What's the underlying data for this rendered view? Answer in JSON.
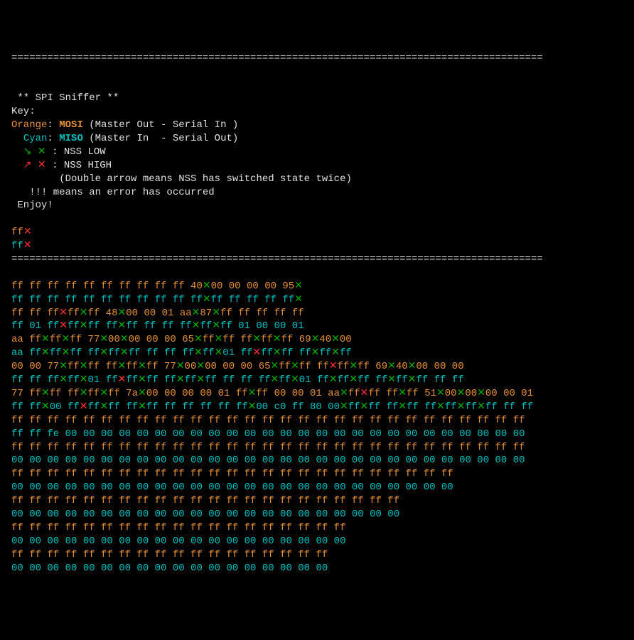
{
  "divider": "=========================================================================================",
  "header": {
    "title": " ** SPI Sniffer **",
    "key_label": "Key:",
    "orange_label": "Orange",
    "mosi": "MOSI",
    "mosi_desc": " (Master Out - Serial In )",
    "cyan_label": "Cyan",
    "miso": "MISO",
    "miso_desc": " (Master In  - Serial Out)",
    "nss_low_arrows": "  ↘ ✕",
    "nss_low_text": " : NSS LOW",
    "nss_high_arrows": "  ↗ ✕",
    "nss_high_text": " : NSS HIGH",
    "double_arrow": "        (Double arrow means NSS has switched state twice)",
    "err_text": "   !!! means an error has occurred",
    "enjoy": " Enjoy!"
  },
  "pre_lines": [
    [
      [
        "orange",
        "ff"
      ],
      [
        "red",
        "✕"
      ]
    ],
    [
      [
        "cyan",
        "ff"
      ],
      [
        "red",
        "✕"
      ]
    ]
  ],
  "lines": [
    [
      [
        "orange",
        "ff ff ff ff ff ff ff ff ff ff 40"
      ],
      [
        "green",
        "✕"
      ],
      [
        "orange",
        "00 00 00 00 95"
      ],
      [
        "green",
        "✕"
      ]
    ],
    [
      [
        "cyan",
        "ff ff ff ff ff ff ff ff ff ff ff"
      ],
      [
        "green",
        "✕"
      ],
      [
        "cyan",
        "ff ff ff ff ff"
      ],
      [
        "green",
        "✕"
      ]
    ],
    [
      [
        "orange",
        "ff ff ff"
      ],
      [
        "red",
        "✕"
      ],
      [
        "orange",
        "ff"
      ],
      [
        "green",
        "✕"
      ],
      [
        "orange",
        "ff 48"
      ],
      [
        "green",
        "✕"
      ],
      [
        "orange",
        "00 00 01 aa"
      ],
      [
        "green",
        "✕"
      ],
      [
        "orange",
        "87"
      ],
      [
        "green",
        "✕"
      ],
      [
        "orange",
        "ff ff ff ff ff"
      ]
    ],
    [
      [
        "cyan",
        "ff 01 ff"
      ],
      [
        "red",
        "✕"
      ],
      [
        "cyan",
        "ff"
      ],
      [
        "green",
        "✕"
      ],
      [
        "cyan",
        "ff ff"
      ],
      [
        "green",
        "✕"
      ],
      [
        "cyan",
        "ff ff ff ff"
      ],
      [
        "green",
        "✕"
      ],
      [
        "cyan",
        "ff"
      ],
      [
        "green",
        "✕"
      ],
      [
        "cyan",
        "ff 01 00 00 01"
      ]
    ],
    [
      [
        "orange",
        "aa ff"
      ],
      [
        "green",
        "✕"
      ],
      [
        "orange",
        "ff"
      ],
      [
        "green",
        "✕"
      ],
      [
        "orange",
        "ff 77"
      ],
      [
        "green",
        "✕"
      ],
      [
        "orange",
        "00"
      ],
      [
        "green",
        "✕"
      ],
      [
        "orange",
        "00 00 00 65"
      ],
      [
        "green",
        "✕"
      ],
      [
        "orange",
        "ff"
      ],
      [
        "green",
        "✕"
      ],
      [
        "orange",
        "ff ff"
      ],
      [
        "green",
        "✕"
      ],
      [
        "orange",
        "ff"
      ],
      [
        "green",
        "✕"
      ],
      [
        "orange",
        "ff 69"
      ],
      [
        "green",
        "✕"
      ],
      [
        "orange",
        "40"
      ],
      [
        "green",
        "✕"
      ],
      [
        "orange",
        "00"
      ]
    ],
    [
      [
        "cyan",
        "aa ff"
      ],
      [
        "green",
        "✕"
      ],
      [
        "cyan",
        "ff"
      ],
      [
        "green",
        "✕"
      ],
      [
        "cyan",
        "ff ff"
      ],
      [
        "green",
        "✕"
      ],
      [
        "cyan",
        "ff"
      ],
      [
        "green",
        "✕"
      ],
      [
        "cyan",
        "ff ff ff ff"
      ],
      [
        "green",
        "✕"
      ],
      [
        "cyan",
        "ff"
      ],
      [
        "green",
        "✕"
      ],
      [
        "cyan",
        "01 ff"
      ],
      [
        "red",
        "✕"
      ],
      [
        "cyan",
        "ff"
      ],
      [
        "green",
        "✕"
      ],
      [
        "cyan",
        "ff ff"
      ],
      [
        "green",
        "✕"
      ],
      [
        "cyan",
        "ff"
      ],
      [
        "green",
        "✕"
      ],
      [
        "cyan",
        "ff"
      ]
    ],
    [
      [
        "orange",
        "00 00 77"
      ],
      [
        "green",
        "✕"
      ],
      [
        "orange",
        "ff"
      ],
      [
        "green",
        "✕"
      ],
      [
        "orange",
        "ff ff"
      ],
      [
        "green",
        "✕"
      ],
      [
        "orange",
        "ff"
      ],
      [
        "green",
        "✕"
      ],
      [
        "orange",
        "ff 77"
      ],
      [
        "green",
        "✕"
      ],
      [
        "orange",
        "00"
      ],
      [
        "green",
        "✕"
      ],
      [
        "orange",
        "00 00 00 65"
      ],
      [
        "green",
        "✕"
      ],
      [
        "orange",
        "ff"
      ],
      [
        "green",
        "✕"
      ],
      [
        "orange",
        "ff ff"
      ],
      [
        "red",
        "✕"
      ],
      [
        "orange",
        "ff"
      ],
      [
        "green",
        "✕"
      ],
      [
        "orange",
        "ff 69"
      ],
      [
        "green",
        "✕"
      ],
      [
        "orange",
        "40"
      ],
      [
        "green",
        "✕"
      ],
      [
        "orange",
        "00 00 00"
      ]
    ],
    [
      [
        "cyan",
        "ff ff ff"
      ],
      [
        "green",
        "✕"
      ],
      [
        "cyan",
        "ff"
      ],
      [
        "green",
        "✕"
      ],
      [
        "cyan",
        "01 ff"
      ],
      [
        "red",
        "✕"
      ],
      [
        "cyan",
        "ff"
      ],
      [
        "green",
        "✕"
      ],
      [
        "cyan",
        "ff ff"
      ],
      [
        "green",
        "✕"
      ],
      [
        "cyan",
        "ff"
      ],
      [
        "green",
        "✕"
      ],
      [
        "cyan",
        "ff ff ff ff"
      ],
      [
        "green",
        "✕"
      ],
      [
        "cyan",
        "ff"
      ],
      [
        "green",
        "✕"
      ],
      [
        "cyan",
        "01 ff"
      ],
      [
        "green",
        "✕"
      ],
      [
        "cyan",
        "ff"
      ],
      [
        "green",
        "✕"
      ],
      [
        "cyan",
        "ff ff"
      ],
      [
        "green",
        "✕"
      ],
      [
        "cyan",
        "ff"
      ],
      [
        "green",
        "✕"
      ],
      [
        "cyan",
        "ff ff ff"
      ]
    ],
    [
      [
        "orange",
        "77 ff"
      ],
      [
        "green",
        "✕"
      ],
      [
        "orange",
        "ff ff"
      ],
      [
        "green",
        "✕"
      ],
      [
        "orange",
        "ff"
      ],
      [
        "green",
        "✕"
      ],
      [
        "orange",
        "ff 7a"
      ],
      [
        "green",
        "✕"
      ],
      [
        "orange",
        "00 00 00 00 01 ff"
      ],
      [
        "green",
        "✕"
      ],
      [
        "orange",
        "ff 00 00 01 aa"
      ],
      [
        "green",
        "✕"
      ],
      [
        "orange",
        "ff"
      ],
      [
        "red",
        "✕"
      ],
      [
        "orange",
        "ff ff"
      ],
      [
        "green",
        "✕"
      ],
      [
        "orange",
        "ff 51"
      ],
      [
        "green",
        "✕"
      ],
      [
        "orange",
        "00"
      ],
      [
        "green",
        "✕"
      ],
      [
        "orange",
        "00"
      ],
      [
        "green",
        "✕"
      ],
      [
        "orange",
        "00 00 01"
      ]
    ],
    [
      [
        "cyan",
        "ff ff"
      ],
      [
        "green",
        "✕"
      ],
      [
        "cyan",
        "00 ff"
      ],
      [
        "red",
        "✕"
      ],
      [
        "cyan",
        "ff"
      ],
      [
        "green",
        "✕"
      ],
      [
        "cyan",
        "ff ff"
      ],
      [
        "green",
        "✕"
      ],
      [
        "cyan",
        "ff ff ff ff ff ff"
      ],
      [
        "green",
        "✕"
      ],
      [
        "cyan",
        "00 c0 ff 80 00"
      ],
      [
        "green",
        "✕"
      ],
      [
        "cyan",
        "ff"
      ],
      [
        "green",
        "✕"
      ],
      [
        "cyan",
        "ff ff"
      ],
      [
        "green",
        "✕"
      ],
      [
        "cyan",
        "ff ff"
      ],
      [
        "green",
        "✕"
      ],
      [
        "cyan",
        "ff"
      ],
      [
        "green",
        "✕"
      ],
      [
        "cyan",
        "ff"
      ],
      [
        "green",
        "✕"
      ],
      [
        "cyan",
        "ff ff ff"
      ]
    ],
    [
      [
        "orange",
        "ff ff ff ff ff ff ff ff ff ff ff ff ff ff ff ff ff ff ff ff ff ff ff ff ff ff ff ff ff"
      ]
    ],
    [
      [
        "cyan",
        "ff ff fe 00 00 00 00 00 00 00 00 00 00 00 00 00 00 00 00 00 00 00 00 00 00 00 00 00 00"
      ]
    ],
    [
      [
        "orange",
        "ff ff ff ff ff ff ff ff ff ff ff ff ff ff ff ff ff ff ff ff ff ff ff ff ff ff ff ff ff"
      ]
    ],
    [
      [
        "cyan",
        "00 00 00 00 00 00 00 00 00 00 00 00 00 00 00 00 00 00 00 00 00 00 00 00 00 00 00 00 00"
      ]
    ],
    [
      [
        "orange",
        "ff ff ff ff ff ff ff ff ff ff ff ff ff ff ff ff ff ff ff ff ff ff ff ff ff"
      ]
    ],
    [
      [
        "cyan",
        "00 00 00 00 00 00 00 00 00 00 00 00 00 00 00 00 00 00 00 00 00 00 00 00 00"
      ]
    ],
    [
      [
        "orange",
        "ff ff ff ff ff ff ff ff ff ff ff ff ff ff ff ff ff ff ff ff ff ff"
      ]
    ],
    [
      [
        "cyan",
        "00 00 00 00 00 00 00 00 00 00 00 00 00 00 00 00 00 00 00 00 00 00"
      ]
    ],
    [
      [
        "orange",
        "ff ff ff ff ff ff ff ff ff ff ff ff ff ff ff ff ff ff ff"
      ]
    ],
    [
      [
        "cyan",
        "00 00 00 00 00 00 00 00 00 00 00 00 00 00 00 00 00 00 00"
      ]
    ],
    [
      [
        "orange",
        "ff ff ff ff ff ff ff ff ff ff ff ff ff ff ff ff ff ff"
      ]
    ],
    [
      [
        "cyan",
        "00 00 00 00 00 00 00 00 00 00 00 00 00 00 00 00 00 00"
      ]
    ]
  ]
}
